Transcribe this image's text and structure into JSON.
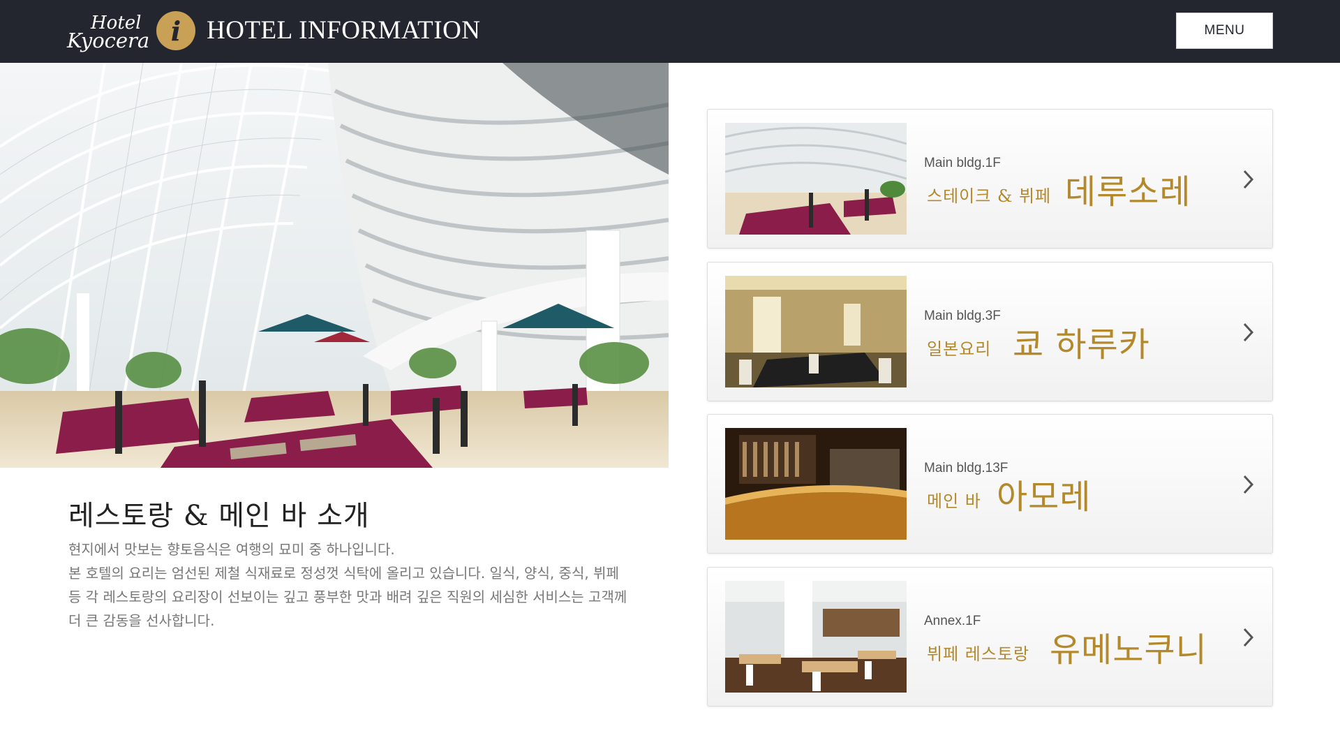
{
  "header": {
    "logo_line1": "Hotel",
    "logo_line2": "Kyocera",
    "info_icon": "i",
    "title": "HOTEL INFORMATION",
    "menu_label": "MENU"
  },
  "intro": {
    "title": "레스토랑 & 메인 바 소개",
    "lines": [
      "현지에서 맛보는 향토음식은 여행의 묘미 중 하나입니다.",
      "본 호텔의 요리는 엄선된 제철 식재료로 정성껏 식탁에 올리고 있습니다. 일식, 양식, 중식, 뷔페",
      "등 각 레스토랑의 요리장이 선보이는 깊고 풍부한 맛과 배려 깊은 직원의 세심한 서비스는 고객께",
      "더 큰 감동을 선사합니다."
    ]
  },
  "restaurants": [
    {
      "location": "Main bldg.1F",
      "category": "스테이크 & 뷔페",
      "name": "데루소레"
    },
    {
      "location": "Main bldg.3F",
      "category": "일본요리",
      "name": "쿄 하루카"
    },
    {
      "location": "Main bldg.13F",
      "category": "메인 바",
      "name": "아모레"
    },
    {
      "location": "Annex.1F",
      "category": "뷔페 레스토랑",
      "name": "유메노쿠니"
    }
  ],
  "colors": {
    "header_bg": "#23252f",
    "accent_gold": "#b3892c",
    "info_badge": "#c9a156"
  },
  "icons": {
    "info": "info-icon",
    "card_arrow": "chevron-right-icon"
  }
}
